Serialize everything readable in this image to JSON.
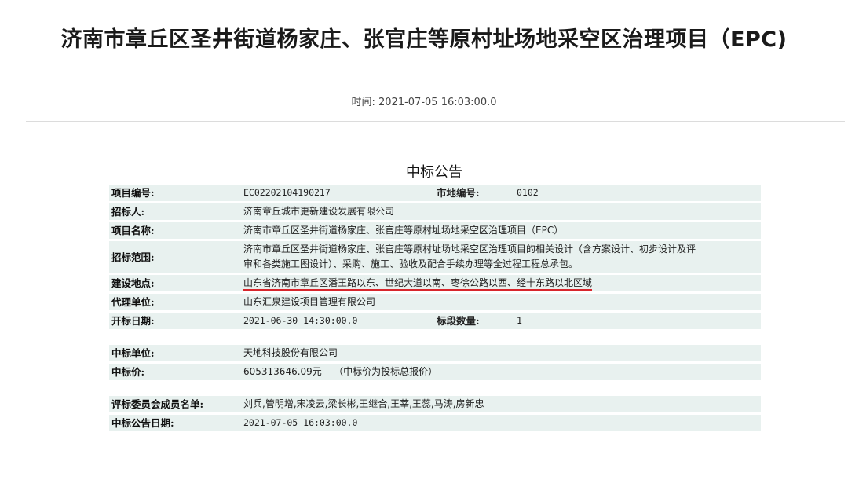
{
  "header": {
    "title": "济南市章丘区圣井街道杨家庄、张官庄等原村址场地采空区治理项目（EPC)",
    "time_label": "时间:",
    "time_value": "2021-07-05 16:03:00.0"
  },
  "notice": {
    "title": "中标公告",
    "project_no_label": "项目编号:",
    "project_no": "EC02202104190217",
    "market_no_label": "市地编号:",
    "market_no": "0102",
    "tenderer_label": "招标人:",
    "tenderer": "济南章丘城市更新建设发展有限公司",
    "project_name_label": "项目名称:",
    "project_name": "济南市章丘区圣井街道杨家庄、张官庄等原村址场地采空区治理项目（EPC）",
    "scope_label": "招标范围:",
    "scope_line1": "济南市章丘区圣井街道杨家庄、张官庄等原村址场地采空区治理项目的相关设计（含方案设计、初步设计及评",
    "scope_line2": "审和各类施工图设计）、采购、施工、验收及配合手续办理等全过程工程总承包。",
    "location_label": "建设地点:",
    "location": "山东省济南市章丘区潘王路以东、世纪大道以南、枣徐公路以西、经十东路以北区域",
    "agent_label": "代理单位:",
    "agent": "山东汇泉建设项目管理有限公司",
    "open_date_label": "开标日期:",
    "open_date": "2021-06-30 14:30:00.0",
    "sections_label": "标段数量:",
    "sections": "1",
    "winner_label": "中标单位:",
    "winner": "天地科技股份有限公司",
    "price_label": "中标价:",
    "price": "605313646.09元",
    "price_note": "（中标价为投标总报价）",
    "committee_label": "评标委员会成员名单:",
    "committee": "刘兵,管明增,宋凌云,梁长彬,王继合,王莘,王蕊,马涛,房新忠",
    "notice_date_label": "中标公告日期:",
    "notice_date": "2021-07-05 16:03:00.0"
  },
  "colors": {
    "row_bg": "#e8f1ef",
    "underline": "#d8262c"
  }
}
